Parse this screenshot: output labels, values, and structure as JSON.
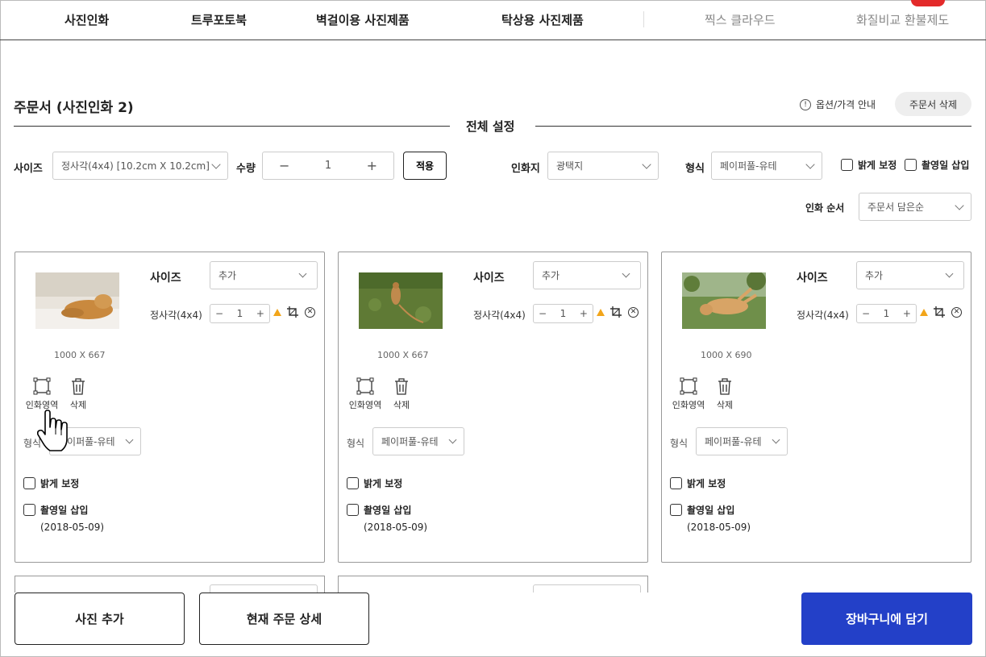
{
  "nav": {
    "items": [
      "사진인화",
      "트루포토북",
      "벽걸이용 사진제품",
      "탁상용 사진제품",
      "찍스 클라우드",
      "화질비교 환불제도"
    ]
  },
  "header": {
    "order_title": "주문서 (사진인화 2)",
    "option_info": "옵션/가격 안내",
    "delete_order": "주문서 삭제",
    "settings_title": "전체 설정"
  },
  "settings": {
    "size_label": "사이즈",
    "size_value": "정사각(4x4)  [10.2cm X 10.2cm]",
    "qty_label": "수량",
    "qty_value": "1",
    "apply": "적용",
    "paper_label": "인화지",
    "paper_value": "광택지",
    "type_label": "형식",
    "type_value": "페이퍼풀-유테",
    "brighten": "밝게 보정",
    "date_insert": "촬영일 삽입",
    "order_label": "인화 순서",
    "order_value": "주문서 담은순"
  },
  "cards": [
    {
      "size_label": "사이즈",
      "size_value": "추가",
      "format": "정사각(4x4)",
      "qty": "1",
      "dimensions": "1000 X 667",
      "area_label": "인화영역",
      "delete_label": "삭제",
      "type_label": "형식",
      "type_value": "페이퍼풀-유테",
      "brighten": "밝게 보정",
      "date_insert": "촬영일 삽입",
      "date": "(2018-05-09)"
    },
    {
      "size_label": "사이즈",
      "size_value": "추가",
      "format": "정사각(4x4)",
      "qty": "1",
      "dimensions": "1000 X 667",
      "area_label": "인화영역",
      "delete_label": "삭제",
      "type_label": "형식",
      "type_value": "페이퍼풀-유테",
      "brighten": "밝게 보정",
      "date_insert": "촬영일 삽입",
      "date": "(2018-05-09)"
    },
    {
      "size_label": "사이즈",
      "size_value": "추가",
      "format": "정사각(4x4)",
      "qty": "1",
      "dimensions": "1000 X 690",
      "area_label": "인화영역",
      "delete_label": "삭제",
      "type_label": "형식",
      "type_value": "페이퍼풀-유테",
      "brighten": "밝게 보정",
      "date_insert": "촬영일 삽입",
      "date": "(2018-05-09)"
    }
  ],
  "footer": {
    "add_photo": "사진 추가",
    "order_detail": "현재 주문 상세",
    "add_to_cart": "장바구니에 담기"
  },
  "colors": {
    "primary": "#2340c8",
    "badge": "#e32a2a",
    "warning": "#f2a51a"
  }
}
